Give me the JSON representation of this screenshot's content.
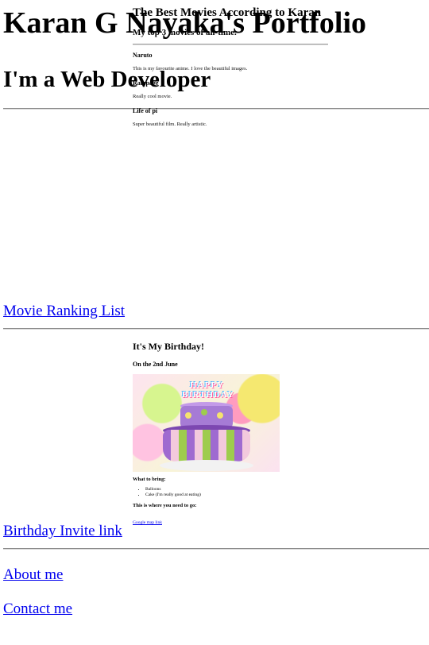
{
  "header": {
    "title": "Karan G Nayaka's Portfolio",
    "subtitle": "I'm a Web Developer"
  },
  "movies": {
    "title": "The Best Movies According to Karan",
    "subheading": "My top 3 movies of all-time.",
    "items": [
      {
        "name": "Naruto",
        "desc": "This is my favourite anime. I love the beautiful images."
      },
      {
        "name": "Rampage",
        "desc": "Really cool movie."
      },
      {
        "name": "Life of pi",
        "desc": "Super beautiful film. Really artistic."
      }
    ],
    "link_label": "Movie Ranking List"
  },
  "birthday": {
    "title": "It's My Birthday!",
    "date": "On the 2nd June",
    "cake_text_1": "HAPPY",
    "cake_text_2": "BIRTHDAY",
    "bring_heading": "What to bring:",
    "bring_items": [
      "Balloons",
      "Cake (I'm really good at eating)"
    ],
    "location_heading": "This is where you need to go:",
    "map_link": "Google map link",
    "link_label": "Birthday Invite link"
  },
  "footer": {
    "about": "About me",
    "contact": "Contact me"
  },
  "colors": {
    "link": "#0000ee",
    "rule": "#8c8c8c"
  }
}
